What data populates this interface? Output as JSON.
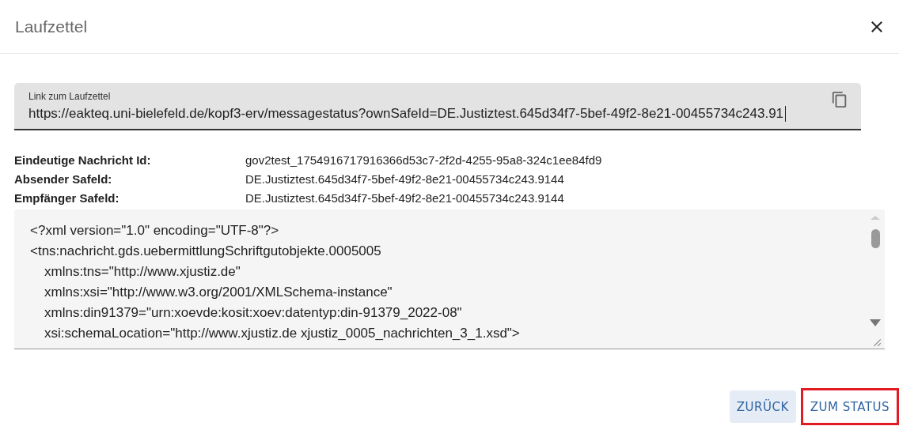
{
  "dialog": {
    "title": "Laufzettel"
  },
  "link_field": {
    "label": "Link zum Laufzettel",
    "value": "https://eakteq.uni-bielefeld.de/kopf3-erv/messagestatus?ownSafeId=DE.Justiztest.645d34f7-5bef-49f2-8e21-00455734c243.91"
  },
  "details": [
    {
      "label": "Eindeutige Nachricht Id:",
      "value": "gov2test_1754916717916366d53c7-2f2d-4255-95a8-324c1ee84fd9"
    },
    {
      "label": "Absender Safeld:",
      "value": "DE.Justiztest.645d34f7-5bef-49f2-8e21-00455734c243.9144"
    },
    {
      "label": "Empfänger Safeld:",
      "value": "DE.Justiztest.645d34f7-5bef-49f2-8e21-00455734c243.9144"
    }
  ],
  "xml_lines": [
    {
      "text": "<?xml version=\"1.0\" encoding=\"UTF-8\"?>"
    },
    {
      "text": "<tns:nachricht.gds.uebermittlungSchriftgutobjekte.0005005",
      "children": [
        {
          "text": "xmlns:tns=\"http://www.xjustiz.de\""
        },
        {
          "text": "xmlns:xsi=\"http://www.w3.org/2001/XMLSchema-instance\""
        },
        {
          "text": "xmlns:din91379=\"urn:xoevde:kosit:xoev:datentyp:din-91379_2022-08\""
        },
        {
          "text": "xsi:schemaLocation=\"http://www.xjustiz.de xjustiz_0005_nachrichten_3_1.xsd\">"
        }
      ]
    }
  ],
  "buttons": [
    {
      "label": "ZURÜCK",
      "kind": "tonal",
      "highlighted": false
    },
    {
      "label": "ZUM STATUS",
      "kind": "text",
      "highlighted": true
    }
  ]
}
